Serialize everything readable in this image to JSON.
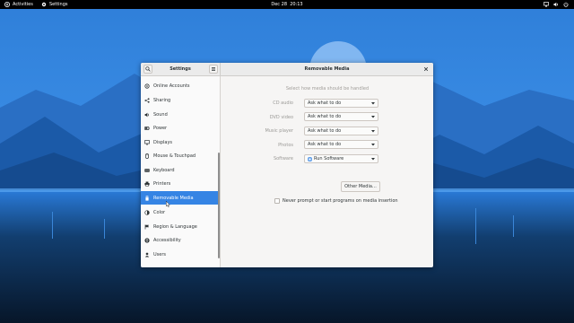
{
  "topbar": {
    "activities_label": "Activities",
    "app_label": "Settings",
    "date": "Dec 28",
    "time": "20:13",
    "tray_icons": [
      "network-icon",
      "volume-icon",
      "power-icon"
    ]
  },
  "window": {
    "sidebar_title": "Settings",
    "title": "Removable Media",
    "search_icon": "search-icon",
    "menu_icon": "hamburger-menu-icon",
    "close_icon": "close-icon"
  },
  "sidebar": {
    "items": [
      {
        "label": "Online Accounts",
        "icon": "online-accounts-icon",
        "selected": false
      },
      {
        "label": "Sharing",
        "icon": "share-icon",
        "selected": false
      },
      {
        "label": "Sound",
        "icon": "speaker-icon",
        "selected": false
      },
      {
        "label": "Power",
        "icon": "power-icon",
        "selected": false
      },
      {
        "label": "Displays",
        "icon": "display-icon",
        "selected": false
      },
      {
        "label": "Mouse & Touchpad",
        "icon": "mouse-icon",
        "selected": false
      },
      {
        "label": "Keyboard",
        "icon": "keyboard-icon",
        "selected": false
      },
      {
        "label": "Printers",
        "icon": "printer-icon",
        "selected": false
      },
      {
        "label": "Removable Media",
        "icon": "usb-icon",
        "selected": true
      },
      {
        "label": "Color",
        "icon": "color-icon",
        "selected": false
      },
      {
        "label": "Region & Language",
        "icon": "flag-icon",
        "selected": false
      },
      {
        "label": "Accessibility",
        "icon": "accessibility-icon",
        "selected": false
      },
      {
        "label": "Users",
        "icon": "users-icon",
        "selected": false
      }
    ]
  },
  "content": {
    "heading": "Select how media should be handled",
    "rows": [
      {
        "label": "CD audio",
        "value": "Ask what to do"
      },
      {
        "label": "DVD video",
        "value": "Ask what to do"
      },
      {
        "label": "Music player",
        "value": "Ask what to do"
      },
      {
        "label": "Photos",
        "value": "Ask what to do"
      },
      {
        "label": "Software",
        "value": "Run Software"
      }
    ],
    "other_media_button": "Other Media…",
    "never_prompt_label": "Never prompt or start programs on media insertion",
    "never_prompt_checked": false
  },
  "colors": {
    "accent": "#3584e4",
    "topbar": "#000000",
    "window_bg": "#f6f5f4",
    "sidebar_bg": "#fafafa"
  }
}
